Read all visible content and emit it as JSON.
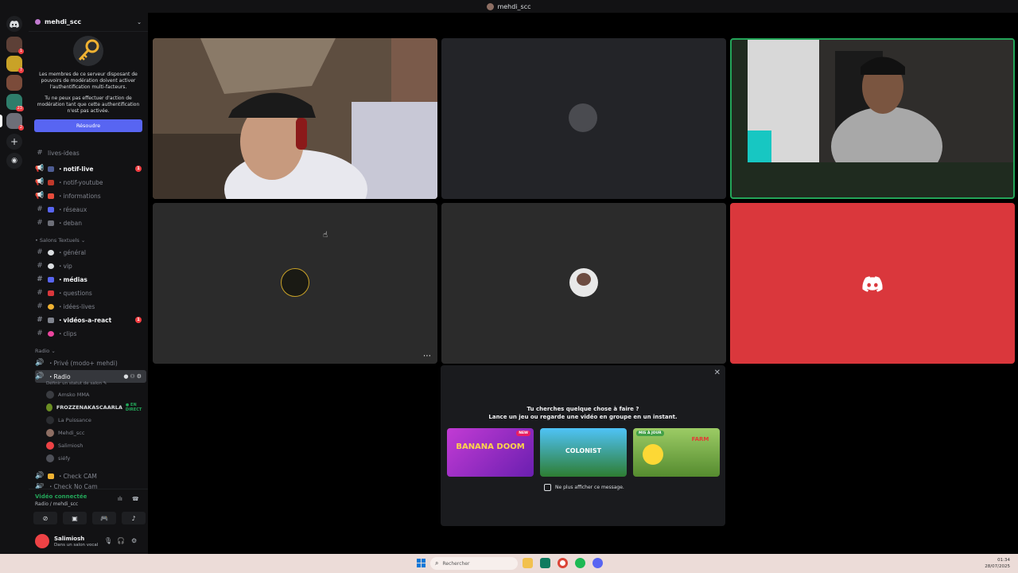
{
  "window": {
    "title": "mehdi_scc"
  },
  "server": {
    "name": "mehdi_scc",
    "mfa_text_1": "Les membres de ce serveur disposant de pouvoirs de modération doivent activer l'authentification multi-facteurs.",
    "mfa_text_2": "Tu ne peux pas effectuer d'action de modération tant que cette authentification n'est pas activée.",
    "resolve_label": "Résoudre"
  },
  "channels": {
    "partial_top": "lives-ideas",
    "notif_live": "・notif-live",
    "notif_live_count": "1",
    "notif_youtube": "・notif-youtube",
    "informations": "・informations",
    "reseaux": "・réseaux",
    "deban": "・deban",
    "cat_text": "• Salons Textuels ⌄",
    "general": "・général",
    "vip": "・vip",
    "medias": "・médias",
    "questions": "・questions",
    "idees_lives": "・idées-lives",
    "videos_react": "・vidéos-a-react",
    "videos_react_count": "1",
    "clips": "・clips",
    "cat_radio": "Radio ⌄",
    "prive": "・Privé (modo+ mehdi)",
    "radio": "・Radio",
    "radio_status": "Définir un statut de salon ✎",
    "check_cam": "・Check CAM",
    "check_no_cam": "・Check No Cam"
  },
  "voice_users": [
    {
      "name": "Amsko MMA",
      "color": "#3a3c41",
      "bright": false
    },
    {
      "name": "FROZZENAKASCAARLA",
      "color": "#6b8e23",
      "bright": true,
      "live": "● EN DIRECT"
    },
    {
      "name": "La Puissance",
      "color": "#2b2d31",
      "bright": false
    },
    {
      "name": "Mehdi_scc",
      "color": "#8d6e63",
      "bright": false
    },
    {
      "name": "Salimiosh",
      "color": "#ed4245",
      "bright": false
    },
    {
      "name": "siéfy",
      "color": "#4e5058",
      "bright": false
    }
  ],
  "voice_panel": {
    "status": "Vidéo connectée",
    "location": "Radio / mehdi_scc"
  },
  "user": {
    "name": "Salimiosh",
    "status": "Dans un salon vocal"
  },
  "activity": {
    "title": "Tu cherches quelque chose à faire ?",
    "subtitle": "Lance un jeu ou regarde une vidéo en groupe en un instant.",
    "games": [
      {
        "name": "BANANA DOOM",
        "tag": "NEW"
      },
      {
        "name": "COLONIST",
        "tag": ""
      },
      {
        "name": "FARM",
        "tag": "MIS À JOUR"
      }
    ],
    "dont_show": "Ne plus afficher ce message."
  },
  "taskbar": {
    "search_placeholder": "Rechercher",
    "time": "01:34",
    "date": "28/07/2025"
  },
  "colors": {
    "accent": "#5865f2",
    "discord_red_tile": "#da373c",
    "speaking_green": "#23a559"
  }
}
